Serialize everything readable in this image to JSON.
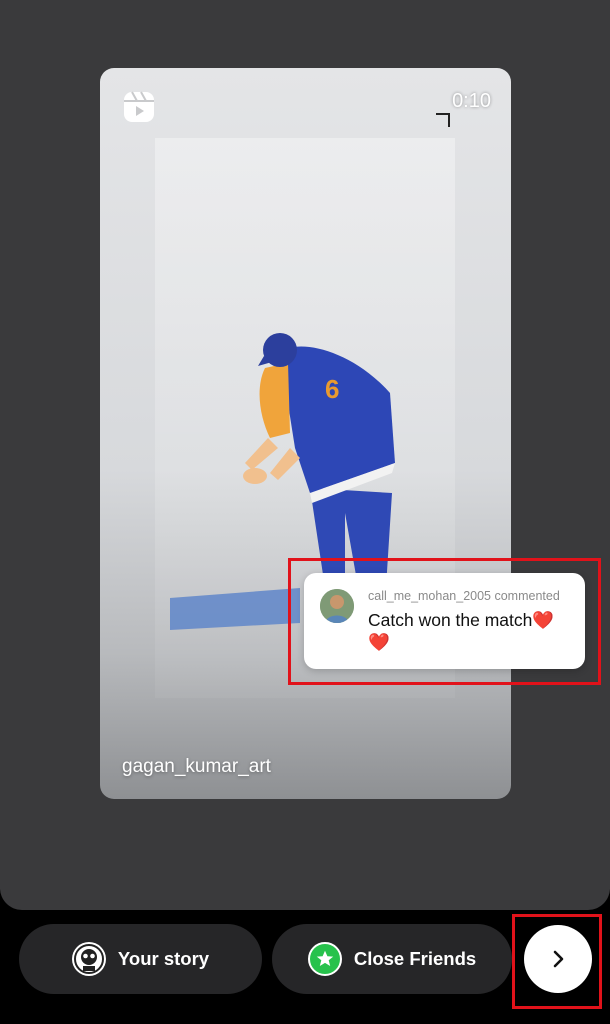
{
  "reel": {
    "duration": "0:10",
    "username": "gagan_kumar_art",
    "reels_icon": "reels-icon",
    "jersey_number": "6"
  },
  "comment_sticker": {
    "author_line": "call_me_mohan_2005 commented",
    "text": "Catch won the match❤️❤️"
  },
  "bottom_bar": {
    "your_story_label": "Your story",
    "close_friends_label": "Close Friends",
    "next_icon": "chevron-right-icon"
  },
  "colors": {
    "highlight": "#e1121a",
    "close_friends_green": "#27c24c",
    "editor_bg": "#3a3a3c"
  }
}
